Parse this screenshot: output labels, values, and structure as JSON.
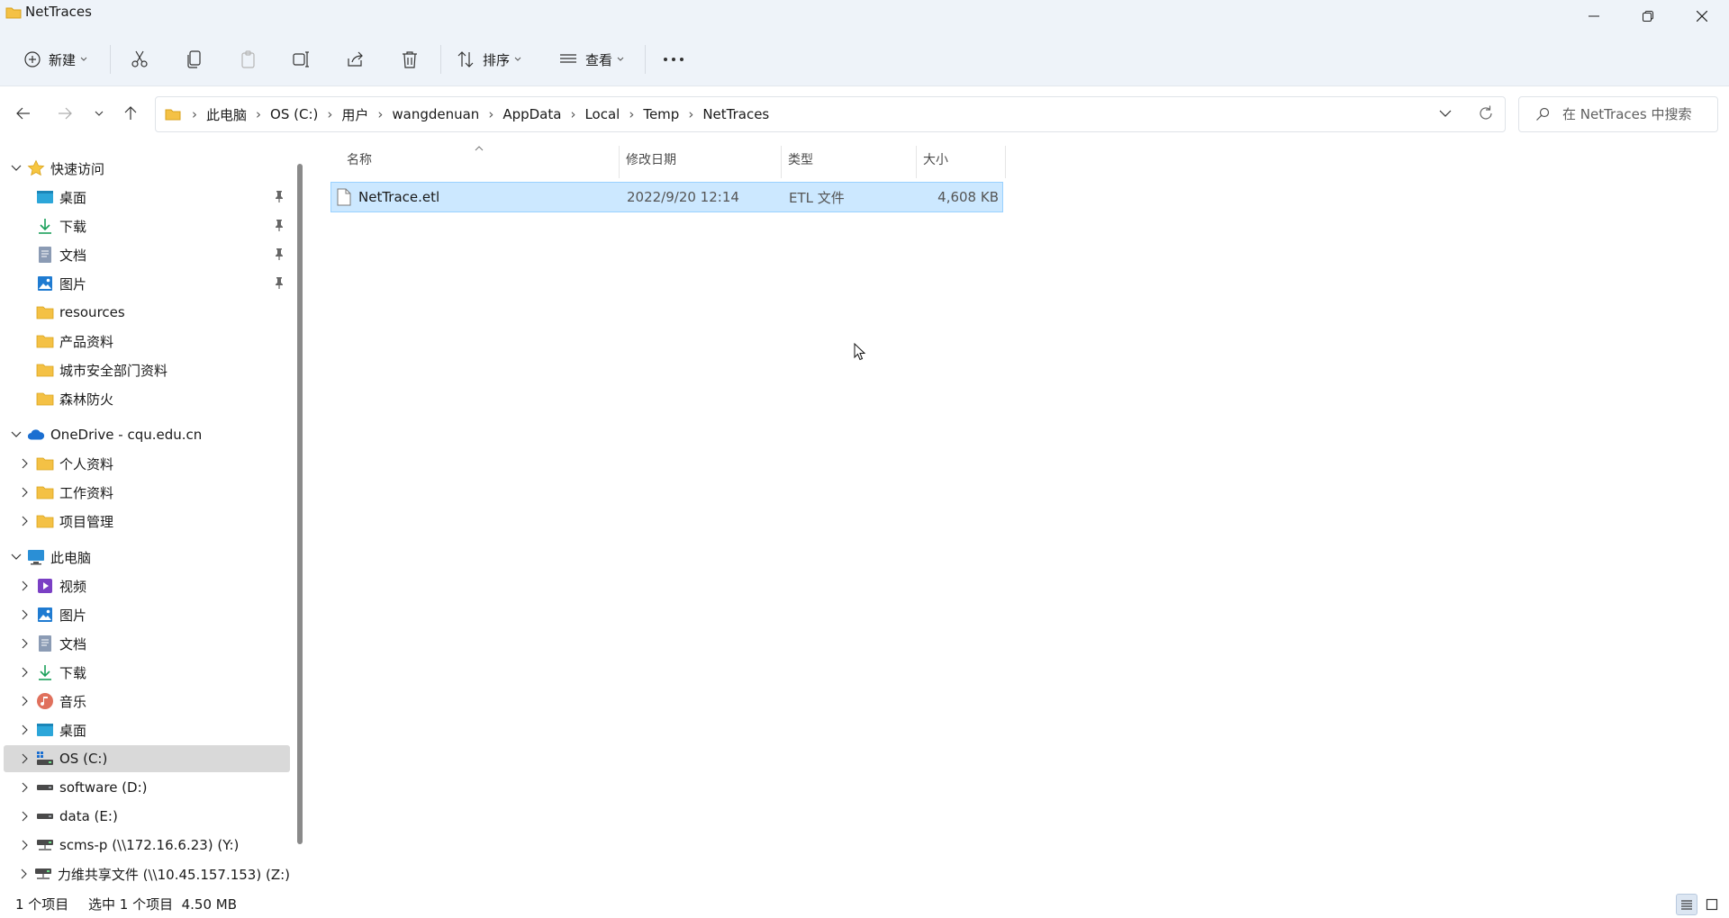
{
  "window": {
    "title": "NetTraces",
    "icon": "folder-icon",
    "controls": [
      "minimize-icon",
      "restore-icon",
      "close-icon"
    ]
  },
  "toolbar": {
    "new_label": "新建",
    "sort_label": "排序",
    "view_label": "查看",
    "icons": [
      "cut-icon",
      "copy-icon",
      "paste-icon",
      "rename-icon",
      "share-icon",
      "delete-icon",
      "more-icon"
    ]
  },
  "address": {
    "crumbs": [
      "此电脑",
      "OS (C:)",
      "用户",
      "wangdenuan",
      "AppData",
      "Local",
      "Temp",
      "NetTraces"
    ]
  },
  "search": {
    "placeholder": "在 NetTraces 中搜索"
  },
  "nav": {
    "quick_access": "快速访问",
    "quick_items": [
      "桌面",
      "下载",
      "文档",
      "图片",
      "resources",
      "产品资料",
      "城市安全部门资料",
      "森林防火"
    ],
    "onedrive": "OneDrive - cqu.edu.cn",
    "onedrive_items": [
      "个人资料",
      "工作资料",
      "项目管理"
    ],
    "this_pc": "此电脑",
    "pc_items": [
      "视频",
      "图片",
      "文档",
      "下载",
      "音乐",
      "桌面",
      "OS (C:)",
      "software (D:)",
      "data (E:)",
      "scms-p (\\\\172.16.6.23) (Y:)",
      "力维共享文件 (\\\\10.45.157.153) (Z:)"
    ]
  },
  "columns": {
    "name": "名称",
    "date": "修改日期",
    "type": "类型",
    "size": "大小"
  },
  "files": [
    {
      "name": "NetTrace.etl",
      "date": "2022/9/20 12:14",
      "type": "ETL 文件",
      "size": "4,608 KB"
    }
  ],
  "status": {
    "count": "1 个项目",
    "selection": "选中 1 个项目  4.50 MB"
  },
  "colors": {
    "titlebar_bg": "#eef3f9",
    "selection_bg": "#cce8ff",
    "selection_border": "#99d1ff",
    "nav_selected": "#d9d9d9"
  }
}
